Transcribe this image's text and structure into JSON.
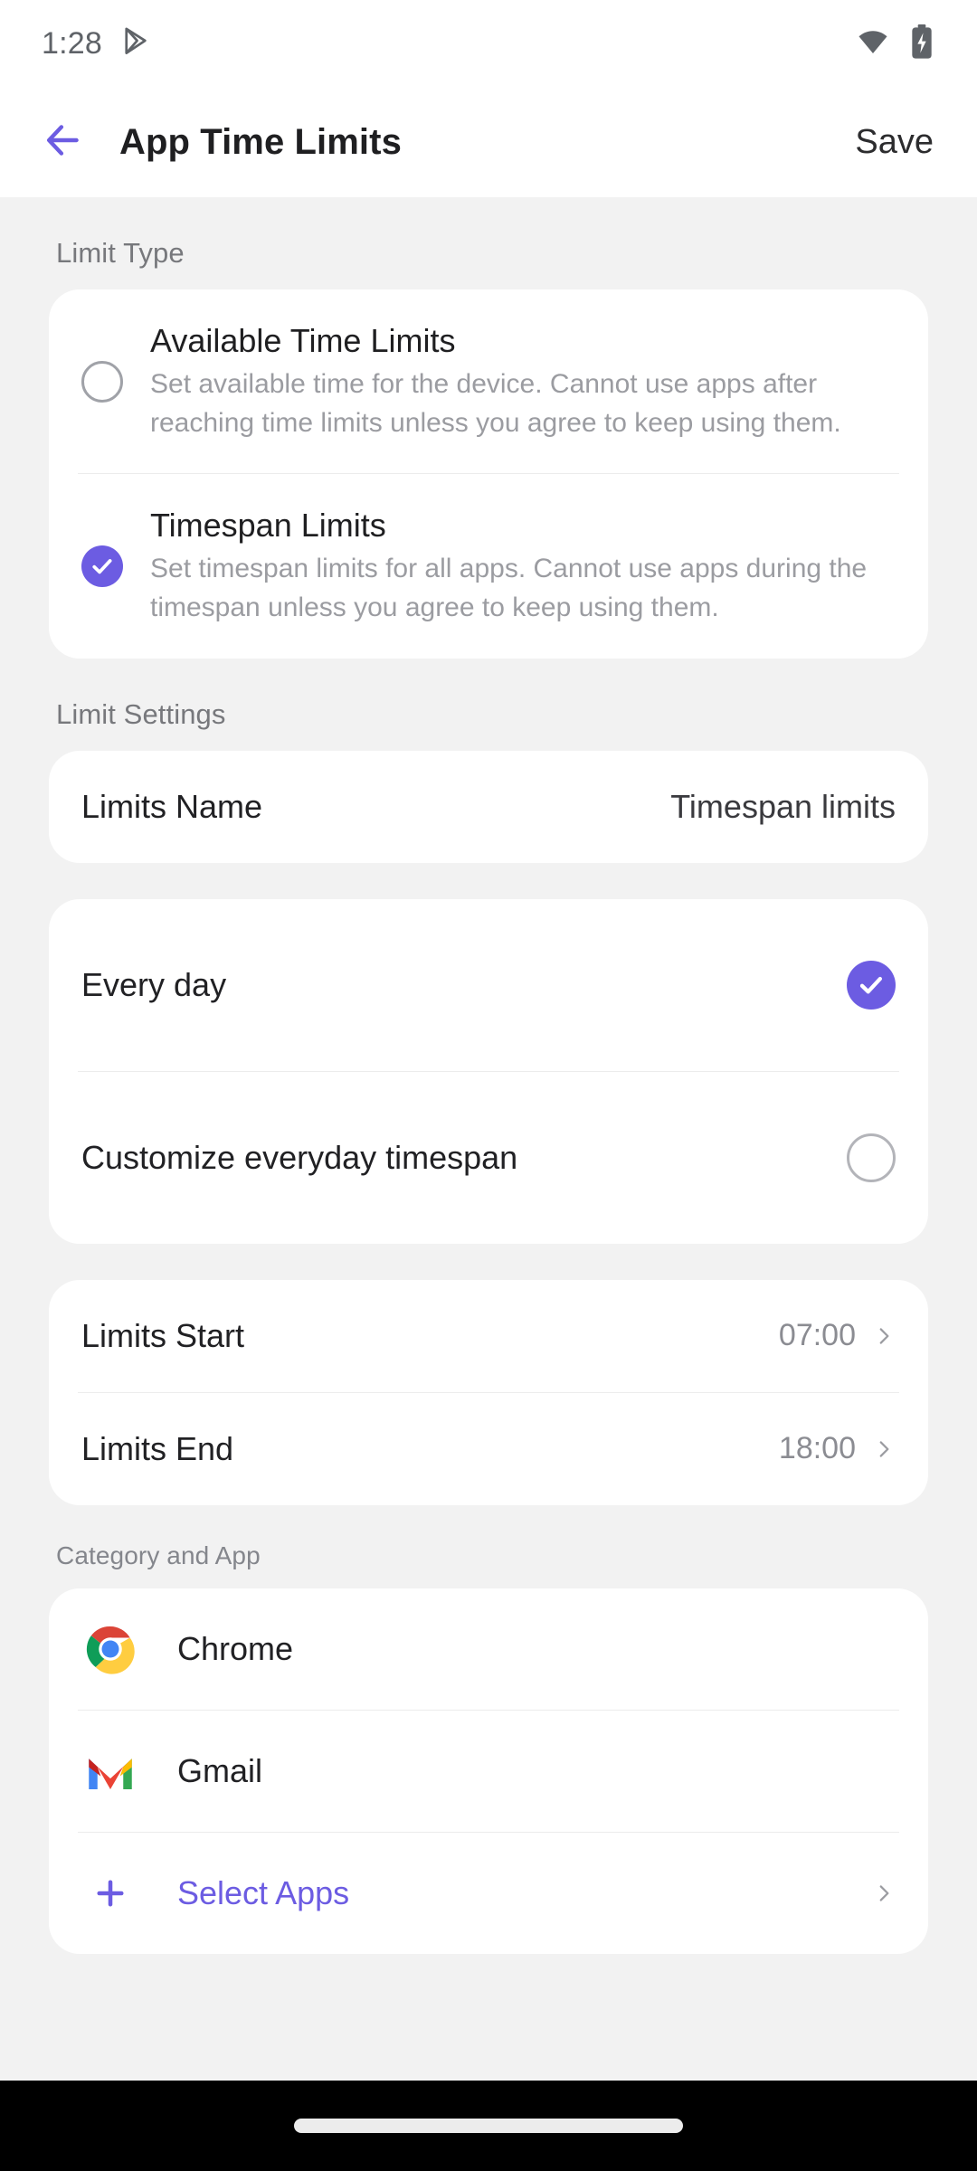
{
  "status_bar": {
    "time": "1:28",
    "icons": [
      "play-store-icon",
      "wifi-icon",
      "battery-charging-icon"
    ]
  },
  "app_bar": {
    "back_icon": "back-arrow-icon",
    "title": "App Time Limits",
    "save_label": "Save"
  },
  "limit_type": {
    "section_label": "Limit Type",
    "options": [
      {
        "title": "Available Time Limits",
        "description": "Set available time for the device. Cannot use apps after reaching time limits unless you agree to keep using them.",
        "selected": false
      },
      {
        "title": "Timespan Limits",
        "description": "Set timespan limits for all apps. Cannot use apps during the timespan unless you agree to keep using them.",
        "selected": true
      }
    ]
  },
  "limit_settings": {
    "section_label": "Limit Settings",
    "limits_name_label": "Limits Name",
    "limits_name_value": "Timespan limits",
    "schedule_options": [
      {
        "label": "Every day",
        "selected": true
      },
      {
        "label": "Customize everyday timespan",
        "selected": false
      }
    ],
    "time_rows": [
      {
        "label": "Limits Start",
        "value": "07:00"
      },
      {
        "label": "Limits End",
        "value": "18:00"
      }
    ]
  },
  "category_and_app": {
    "section_label": "Category and App",
    "apps": [
      {
        "name": "Chrome",
        "icon": "chrome-icon"
      },
      {
        "name": "Gmail",
        "icon": "gmail-icon"
      }
    ],
    "select_apps_label": "Select Apps"
  },
  "colors": {
    "accent_purple": "#6c5ce2",
    "page_background": "#f2f2f2",
    "card_background": "#ffffff",
    "primary_text": "#212124",
    "secondary_text": "#9b9ca1",
    "nav_bar": "#000000"
  }
}
